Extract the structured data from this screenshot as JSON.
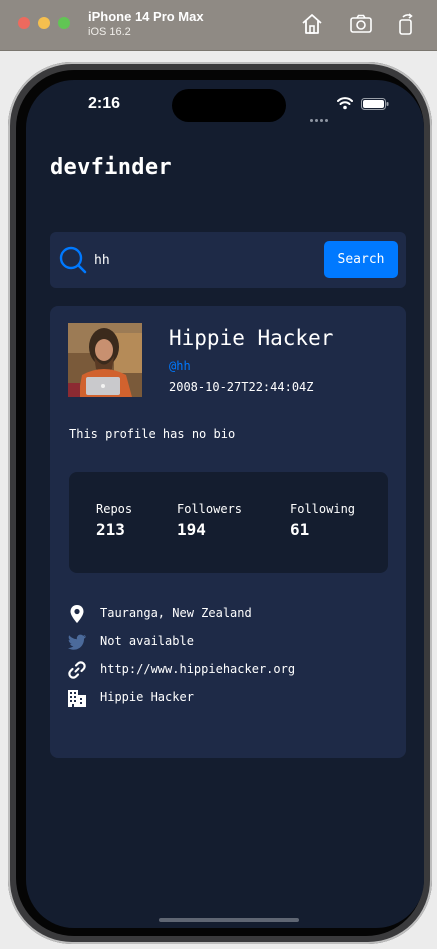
{
  "simulator": {
    "device_name": "iPhone 14 Pro Max",
    "os_version": "iOS 16.2",
    "icons": [
      "home-icon",
      "screenshot-icon",
      "rotate-icon"
    ]
  },
  "status_bar": {
    "time": "2:16"
  },
  "app": {
    "title": "devfinder"
  },
  "search": {
    "value": "hh",
    "button_label": "Search"
  },
  "profile": {
    "name": "Hippie Hacker",
    "login": "@hh",
    "joined": "2008-10-27T22:44:04Z",
    "bio": "This profile has no bio"
  },
  "stats": [
    {
      "label": "Repos",
      "value": "213"
    },
    {
      "label": "Followers",
      "value": "194"
    },
    {
      "label": "Following",
      "value": "61"
    }
  ],
  "links": {
    "location": "Tauranga, New Zealand",
    "twitter": "Not available",
    "blog": "http://www.hippiehacker.org",
    "company": "Hippie Hacker"
  },
  "colors": {
    "accent": "#0079ff",
    "background": "#141d2f",
    "card": "#1e2a47",
    "text": "#ffffff",
    "unavailable_icon": "#4b6a9b"
  }
}
